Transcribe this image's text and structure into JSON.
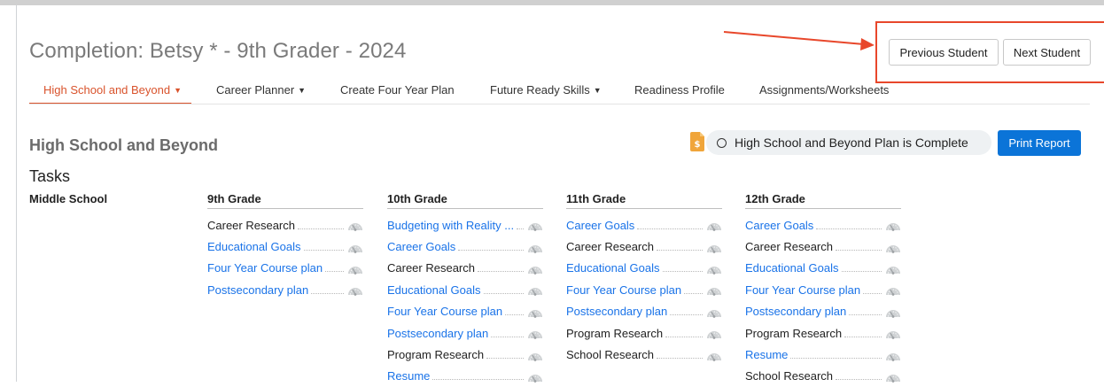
{
  "header": {
    "title": "Completion: Betsy * - 9th Grader - 2024",
    "prev_label": "Previous Student",
    "next_label": "Next Student"
  },
  "tabs": [
    {
      "label": "High School and Beyond",
      "dropdown": true,
      "active": true
    },
    {
      "label": "Career Planner",
      "dropdown": true,
      "active": false
    },
    {
      "label": "Create Four Year Plan",
      "dropdown": false,
      "active": false
    },
    {
      "label": "Future Ready Skills",
      "dropdown": true,
      "active": false
    },
    {
      "label": "Readiness Profile",
      "dropdown": false,
      "active": false
    },
    {
      "label": "Assignments/Worksheets",
      "dropdown": false,
      "active": false
    }
  ],
  "section": {
    "title": "High School and Beyond",
    "complete_label": "High School and Beyond Plan is Complete",
    "print_label": "Print Report",
    "tasks_label": "Tasks"
  },
  "columns": [
    {
      "heading": "Middle School",
      "tasks": []
    },
    {
      "heading": "9th Grade",
      "tasks": [
        {
          "name": "Career Research",
          "link": false
        },
        {
          "name": "Educational Goals",
          "link": true
        },
        {
          "name": "Four Year Course plan",
          "link": true
        },
        {
          "name": "Postsecondary plan",
          "link": true
        }
      ]
    },
    {
      "heading": "10th Grade",
      "tasks": [
        {
          "name": "Budgeting with Reality ...",
          "link": true
        },
        {
          "name": "Career Goals",
          "link": true
        },
        {
          "name": "Career Research",
          "link": false
        },
        {
          "name": "Educational Goals",
          "link": true
        },
        {
          "name": "Four Year Course plan",
          "link": true
        },
        {
          "name": "Postsecondary plan",
          "link": true
        },
        {
          "name": "Program Research",
          "link": false
        },
        {
          "name": "Resume",
          "link": true
        }
      ]
    },
    {
      "heading": "11th Grade",
      "tasks": [
        {
          "name": "Career Goals",
          "link": true
        },
        {
          "name": "Career Research",
          "link": false
        },
        {
          "name": "Educational Goals",
          "link": true
        },
        {
          "name": "Four Year Course plan",
          "link": true
        },
        {
          "name": "Postsecondary plan",
          "link": true
        },
        {
          "name": "Program Research",
          "link": false
        },
        {
          "name": "School Research",
          "link": false
        }
      ]
    },
    {
      "heading": "12th Grade",
      "tasks": [
        {
          "name": "Career Goals",
          "link": true
        },
        {
          "name": "Career Research",
          "link": false
        },
        {
          "name": "Educational Goals",
          "link": true
        },
        {
          "name": "Four Year Course plan",
          "link": true
        },
        {
          "name": "Postsecondary plan",
          "link": true
        },
        {
          "name": "Program Research",
          "link": false
        },
        {
          "name": "Resume",
          "link": true
        },
        {
          "name": "School Research",
          "link": false
        }
      ]
    }
  ],
  "colors": {
    "accent_tab": "#d9532c",
    "link": "#1a73e8",
    "primary_button": "#0b74d8",
    "annotation": "#e8472b"
  }
}
